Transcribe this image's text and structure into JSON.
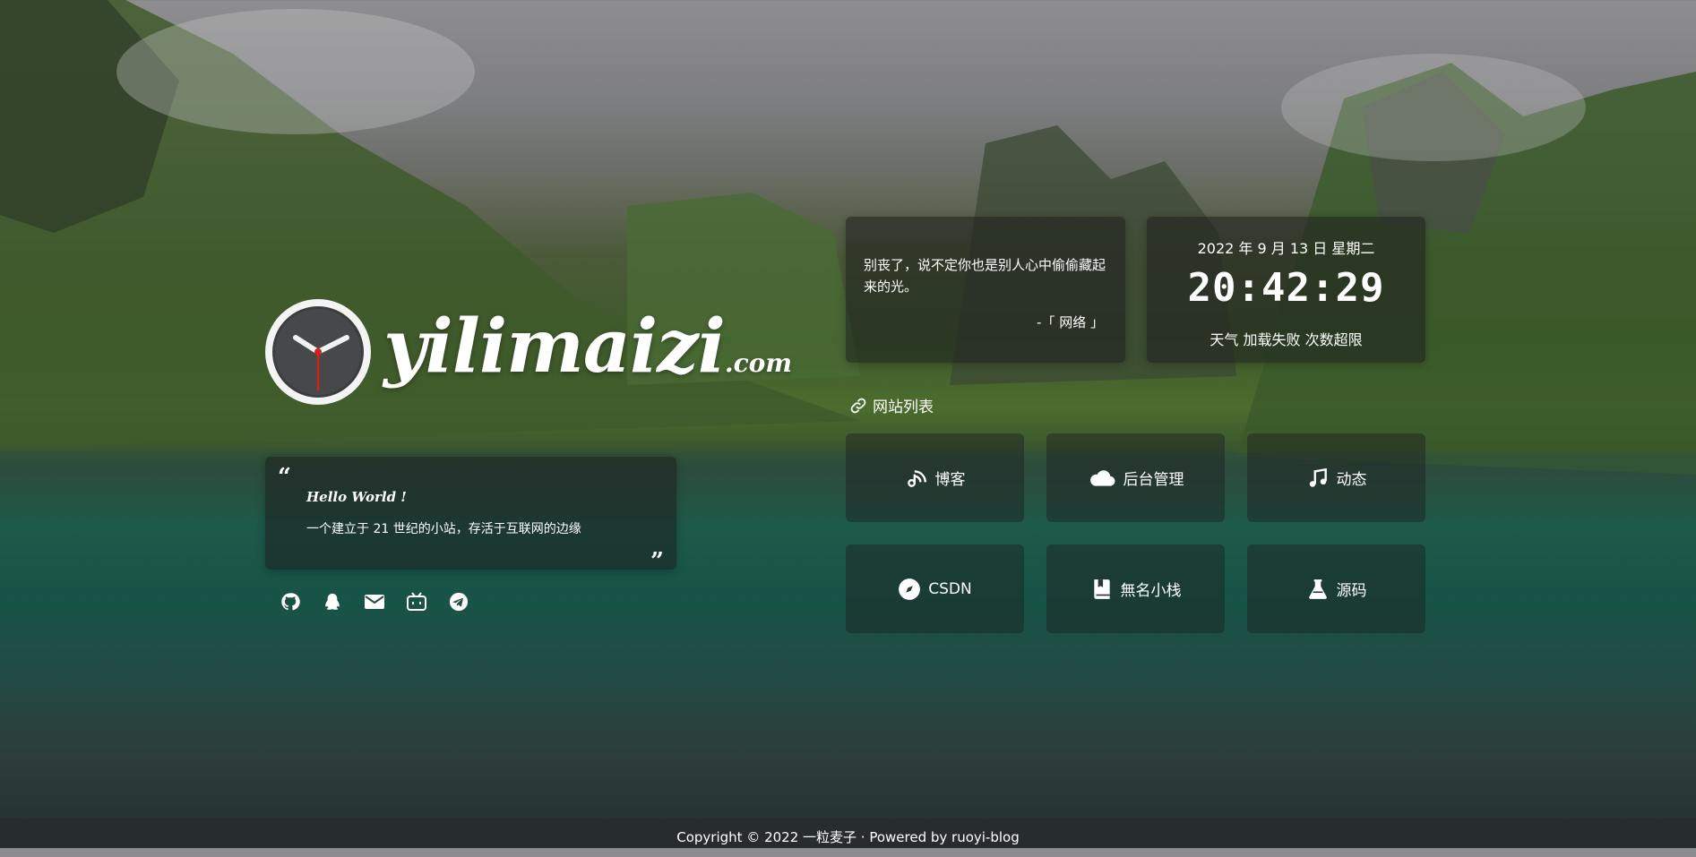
{
  "brand": {
    "name": "yilimaizi",
    "tld": ".com"
  },
  "intro": {
    "open_quote": "“",
    "close_quote": "”",
    "hello": "Hello World !",
    "text": "一个建立于 21 世纪的小站，存活于互联网的边缘"
  },
  "social": [
    {
      "icon": "github-icon"
    },
    {
      "icon": "qq-icon"
    },
    {
      "icon": "mail-icon"
    },
    {
      "icon": "bilibili-icon"
    },
    {
      "icon": "telegram-icon"
    }
  ],
  "quote": {
    "text": "别丧了，说不定你也是别人心中偷偷藏起来的光。",
    "source": "-「 网络 」"
  },
  "datetime": {
    "date": "2022 年 9 月 13 日 星期二",
    "time": "20:42:29",
    "weather": "天气 加载失败 次数超限"
  },
  "sites": {
    "title": "网站列表",
    "title_icon": "link-icon",
    "items": [
      {
        "label": "博客",
        "icon": "blog-icon"
      },
      {
        "label": "后台管理",
        "icon": "cloud-icon"
      },
      {
        "label": "动态",
        "icon": "music-icon"
      },
      {
        "label": "CSDN",
        "icon": "compass-icon"
      },
      {
        "label": "無名小栈",
        "icon": "book-icon"
      },
      {
        "label": "源码",
        "icon": "flask-icon"
      }
    ]
  },
  "footer": {
    "text": "Copyright © 2022 一粒麦子 · Powered by ruoyi-blog"
  }
}
